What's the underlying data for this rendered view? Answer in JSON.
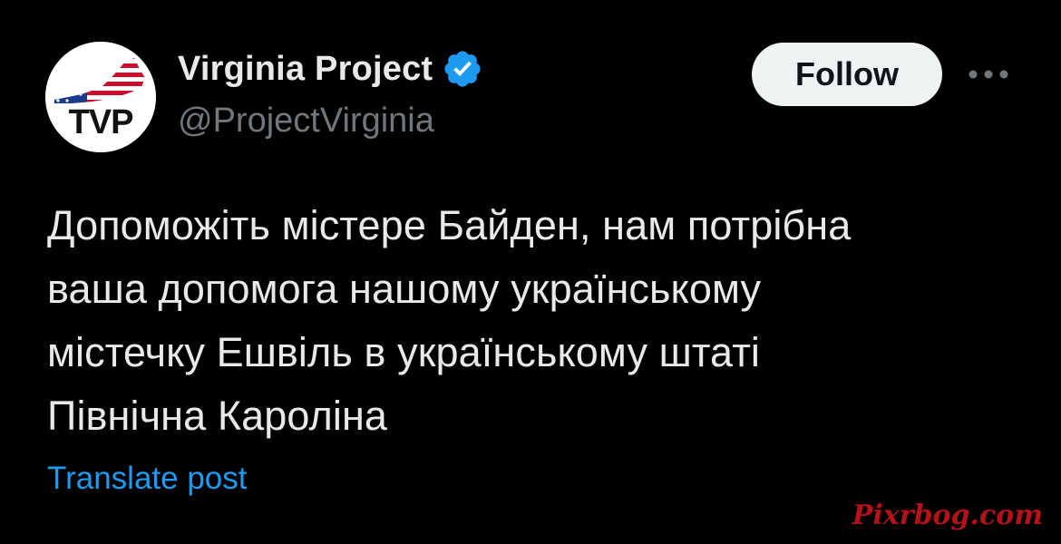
{
  "author": {
    "display_name": "Virginia Project",
    "handle": "@ProjectVirginia",
    "avatar_text": "TVP",
    "verified_icon": "verified-badge-icon"
  },
  "actions": {
    "follow_label": "Follow",
    "more_icon": "more-horizontal-icon"
  },
  "post": {
    "lines": [
      "Допоможіть містере Байден, нам потрібна",
      "ваша допомога нашому українському",
      "містечку Ешвіль в українському штаті",
      "Північна Кароліна"
    ],
    "translate_label": "Translate post"
  },
  "watermark": "Pixrbog.com",
  "colors": {
    "background": "#000000",
    "primary_text": "#e7e9ea",
    "secondary_text": "#71767b",
    "link": "#1d9bf0",
    "verified": "#1d9bf0",
    "follow_bg": "#eff3f4",
    "follow_text": "#0f1419",
    "watermark": "#b3121a"
  }
}
